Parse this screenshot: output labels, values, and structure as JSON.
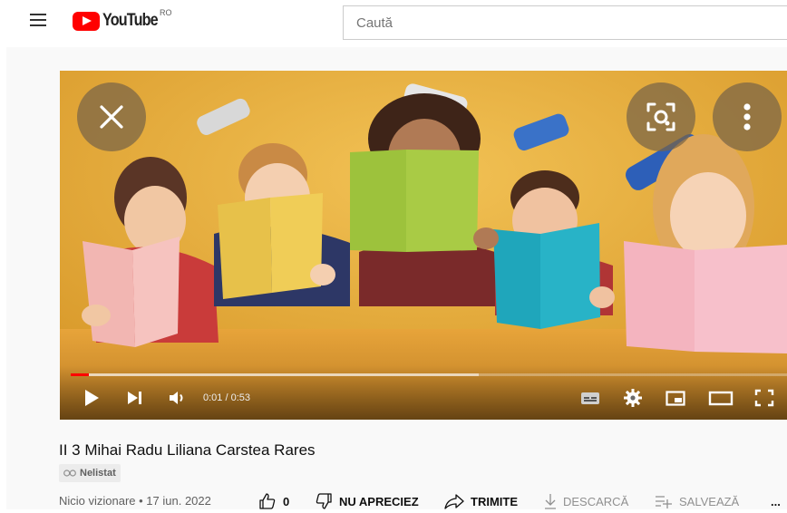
{
  "header": {
    "logo_text": "YouTube",
    "country_code": "RO",
    "search_placeholder": "Caută"
  },
  "player": {
    "current_time": "0:01",
    "duration": "0:53",
    "time_display": "0:01 / 0:53",
    "played_fraction": 0.025,
    "buffered_fraction": 0.57
  },
  "video": {
    "title": "II 3 Mihai Radu Liliana Carstea Rares",
    "visibility": "Nelistat",
    "views": "Nicio vizionare",
    "date": "17 iun. 2022",
    "meta_line": "Nicio vizionare • 17 iun. 2022"
  },
  "actions": {
    "like_count": "0",
    "dislike_label": "NU APRECIEZ",
    "share_label": "TRIMITE",
    "download_label": "DESCARCĂ",
    "save_label": "SALVEAZĂ",
    "more_label": "..."
  },
  "icons": {
    "menu": "hamburger-icon",
    "close": "close-icon",
    "lens": "lens-icon",
    "more": "more-vertical-icon",
    "play": "play-icon",
    "next": "next-icon",
    "volume": "volume-icon",
    "subtitles": "subtitles-icon",
    "settings": "gear-icon",
    "miniplayer": "miniplayer-icon",
    "theater": "theater-icon",
    "fullscreen": "fullscreen-icon"
  },
  "colors": {
    "brand_red": "#ff0000",
    "scene_background": "#e8ad3a"
  }
}
